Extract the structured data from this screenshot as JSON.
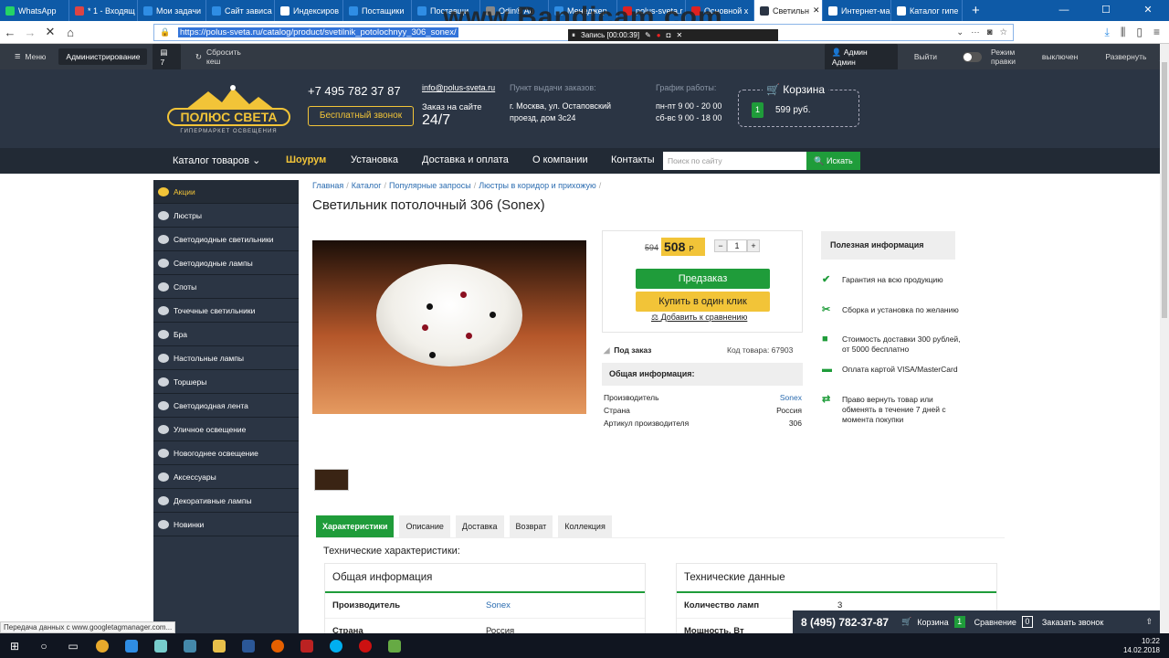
{
  "browser": {
    "tabs": [
      {
        "label": "WhatsApp",
        "color": "#25d366"
      },
      {
        "label": "* 1 - Входящ",
        "color": "#d44"
      },
      {
        "label": "Мои задачи",
        "color": "#2f8de4"
      },
      {
        "label": "Сайт зависа",
        "color": "#2f8de4"
      },
      {
        "label": "Индексиров",
        "color": "#fff"
      },
      {
        "label": "Постащики",
        "color": "#2f8de4"
      },
      {
        "label": "Поставщи",
        "color": "#2f8de4"
      },
      {
        "label": "Odin® Au",
        "color": "#888"
      },
      {
        "label": "Менеджер",
        "color": "#2f8de4"
      },
      {
        "label": "polus-sveta.r",
        "color": "#d22"
      },
      {
        "label": "Основной х",
        "color": "#d22"
      },
      {
        "label": "Светильн",
        "color": "#2b3544"
      },
      {
        "label": "Интернет-ма",
        "color": "#fff"
      },
      {
        "label": "Каталог гипе",
        "color": "#fff"
      }
    ],
    "url": "https://polus-sveta.ru/catalog/product/svetilnik_potolochnyy_306_sonex/",
    "watermark": "www.Bandicam.com",
    "recording": "Запись [00:00:39]"
  },
  "adminbar": {
    "menu": "Меню",
    "admin": "Администрирование",
    "count": "7",
    "cache": "Сбросить кеш",
    "user": "Админ Админ",
    "logout": "Выйти",
    "edit_mode": "Режим правки",
    "edit_state": "выключен",
    "expand": "Развернуть"
  },
  "header": {
    "logo": "ПОЛЮС СВЕТА",
    "logo_sub": "ГИПЕРМАРКЕТ ОСВЕЩЕНИЯ",
    "phone": "+7 495 782 37 87",
    "free_call": "Бесплатный звонок",
    "email": "info@polus-sveta.ru",
    "order_label": "Заказ на сайте",
    "order_hours": "24/7",
    "pickup_label": "Пункт выдачи заказов:",
    "pickup_addr1": "г. Москва, ул. Остаповский",
    "pickup_addr2": "проезд, дом 3с24",
    "sched_label": "График работы:",
    "sched1": "пн-пт 9 00 - 20 00",
    "sched2": "сб-вс 9 00 - 18 00",
    "cart_title": "Корзина",
    "cart_count": "1",
    "cart_sum": "599 руб."
  },
  "menu": {
    "catalog": "Каталог товаров",
    "showroom": "Шоурум",
    "install": "Установка",
    "delivery": "Доставка и оплата",
    "about": "О компании",
    "contacts": "Контакты",
    "search_placeholder": "Поиск по сайту",
    "search_button": "Искать"
  },
  "sidebar": [
    "Акции",
    "Люстры",
    "Светодиодные светильники",
    "Светодиодные лампы",
    "Споты",
    "Точечные светильники",
    "Бра",
    "Настольные лампы",
    "Торшеры",
    "Светодиодная лента",
    "Уличное освещение",
    "Новогоднее освещение",
    "Аксессуары",
    "Декоративные лампы",
    "Новинки"
  ],
  "breadcrumbs": [
    "Главная",
    "Каталог",
    "Популярные запросы",
    "Люстры в коридор и прихожую"
  ],
  "product": {
    "title": "Светильник потолочный 306 (Sonex)",
    "old_price": "594",
    "price": "508",
    "currency": "Р",
    "qty": "1",
    "preorder": "Предзаказ",
    "one_click": "Купить в один клик",
    "compare": "Добавить к сравнению",
    "availability": "Под заказ",
    "code": "Код товара: 67903",
    "general_info": "Общая информация:",
    "rows": [
      {
        "k": "Производитель",
        "v": "Sonex"
      },
      {
        "k": "Страна",
        "v": "Россия"
      },
      {
        "k": "Артикул производителя",
        "v": "306"
      }
    ]
  },
  "useful": {
    "title": "Полезная информация",
    "items": [
      {
        "icon": "✔",
        "text": "Гарантия на всю продукцию"
      },
      {
        "icon": "✂",
        "text": "Сборка и установка по желанию"
      },
      {
        "icon": "■",
        "text": "Стоимость доставки 300 рублей, от 5000 бесплатно"
      },
      {
        "icon": "▬",
        "text": "Оплата картой VISA/MasterCard"
      },
      {
        "icon": "⇄",
        "text": "Право вернуть товар или обменять в течение 7 дней с момента покупки"
      }
    ]
  },
  "product_tabs": [
    "Характеристики",
    "Описание",
    "Доставка",
    "Возврат",
    "Коллекция"
  ],
  "specs": {
    "heading": "Технические характеристики:",
    "general": {
      "title": "Общая информация",
      "rows": [
        {
          "k": "Производитель",
          "v": "Sonex"
        },
        {
          "k": "Страна",
          "v": "Россия"
        }
      ]
    },
    "tech": {
      "title": "Технические данные",
      "rows": [
        {
          "k": "Количество ламп",
          "v": "3"
        },
        {
          "k": "Мощность, Вт",
          "v": ""
        }
      ]
    }
  },
  "bottombar": {
    "phone": "8 (495) 782-37-87",
    "cart": "Корзина",
    "cart_count": "1",
    "compare": "Сравнение",
    "compare_count": "0",
    "callback": "Заказать звонок"
  },
  "status": "Передача данных с www.googletagmanager.com...",
  "clock": {
    "time": "10:22",
    "date": "14.02.2018"
  }
}
